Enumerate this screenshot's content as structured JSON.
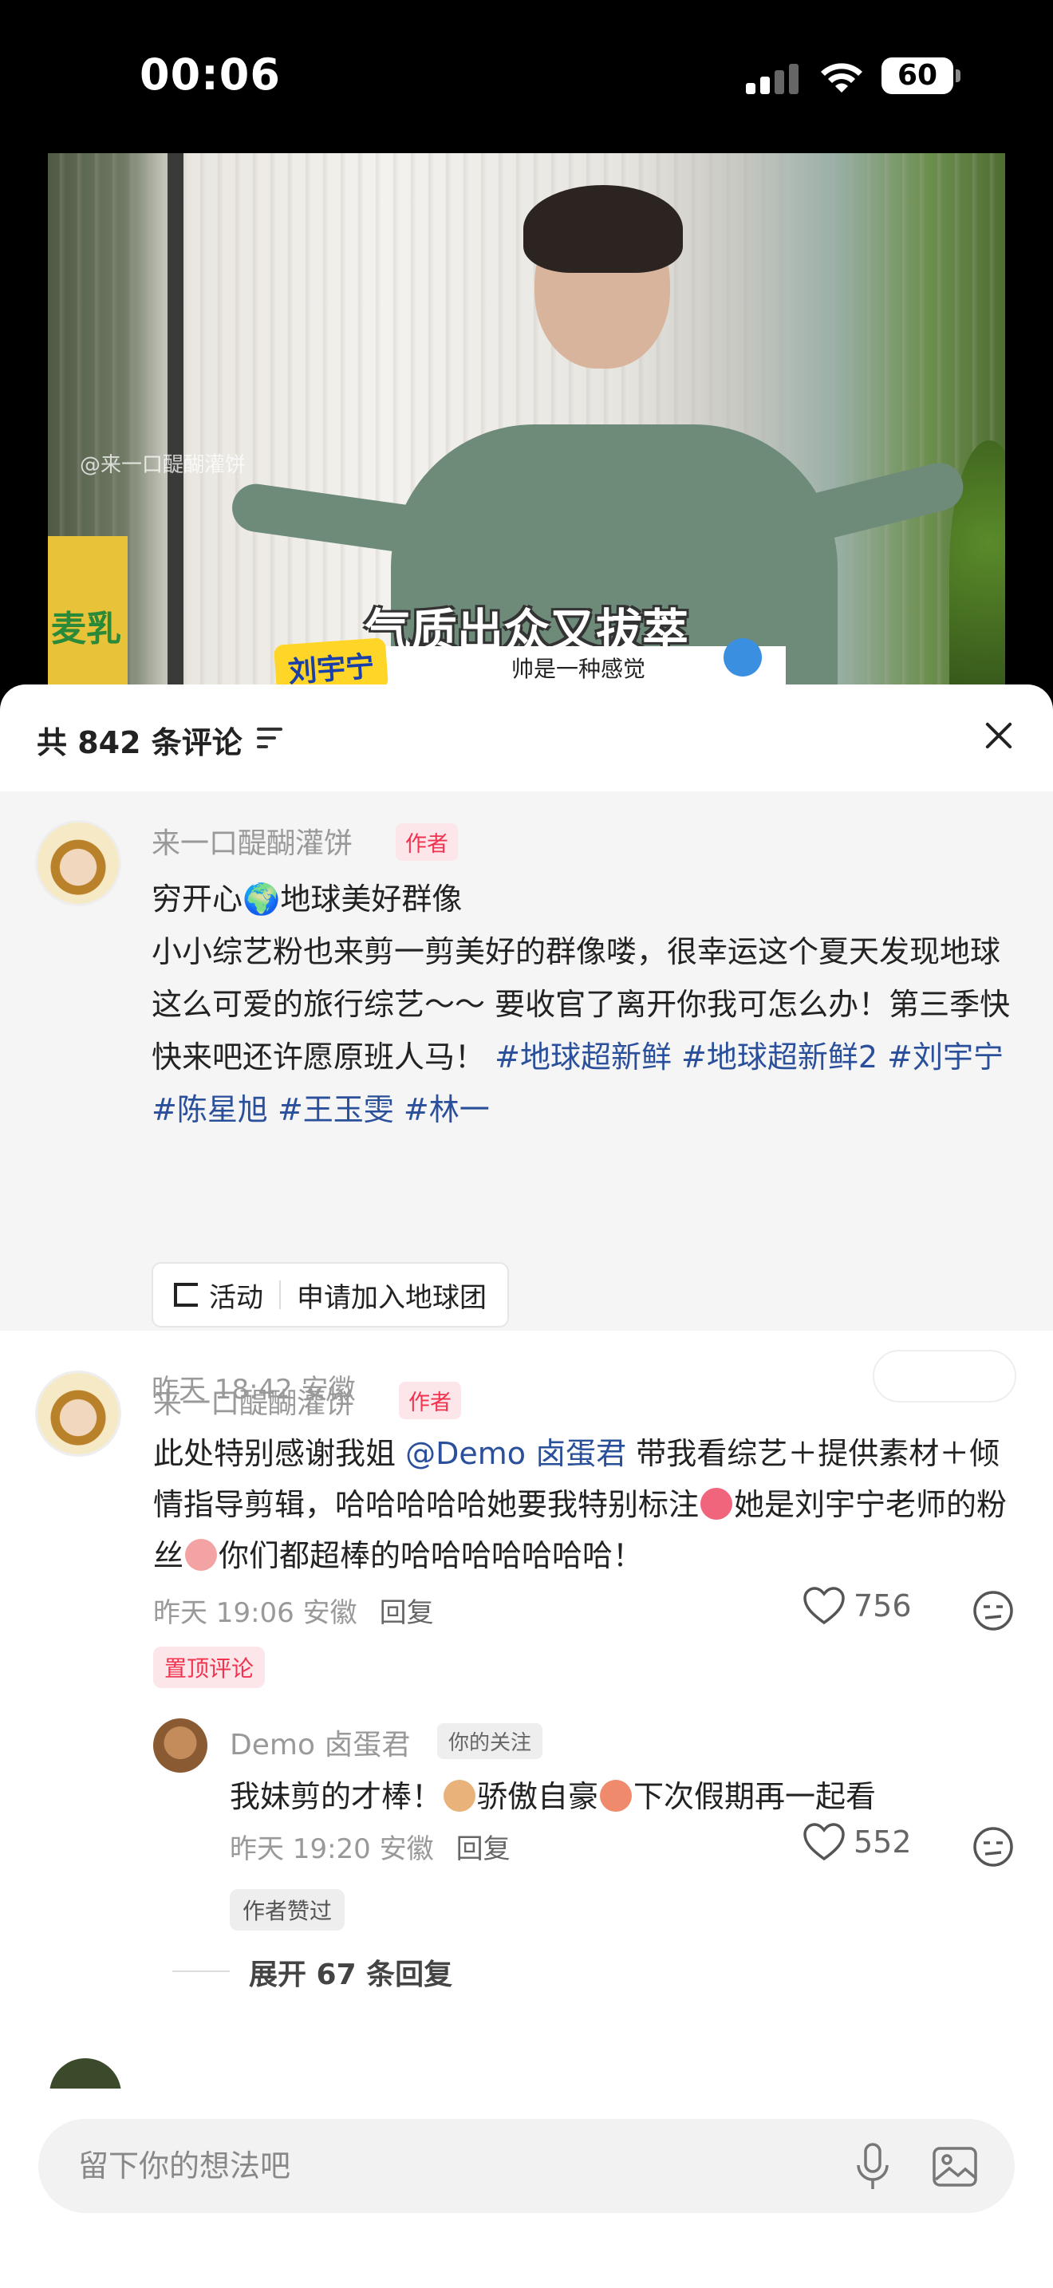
{
  "status_bar": {
    "time": "00:06",
    "battery": "60"
  },
  "video": {
    "subtitle_main": "气质出众又拔萃",
    "name_badge": "刘宇宁",
    "subtitle_sub": "帅是一种感觉"
  },
  "sheet": {
    "comment_count": "共 842 条评论",
    "filter_icon": "filter-icon",
    "close_icon": "close-icon"
  },
  "author_post": {
    "username": "来一口醍醐灌饼",
    "tag": "作者",
    "title": "穷开心🌍地球美好群像",
    "body": "小小综艺粉也来剪一剪美好的群像喽，很幸运这个夏天发现地球这么可爱的旅行综艺～～ 要收官了离开你我可怎么办！第三季快快来吧还许愿原班人马！",
    "hashtags": [
      "#地球超新鲜",
      "#地球超新鲜2",
      "#刘宇宁",
      "#陈星旭",
      "#王玉雯",
      "#林一"
    ],
    "activity_label": "活动",
    "activity_action": "申请加入地球团",
    "meta": "昨天 18:42 安徽"
  },
  "comments": [
    {
      "username": "来一口醍醐灌饼",
      "tag": "作者",
      "text_prefix": "此处特别感谢我姐",
      "mention": "@Demo 卤蛋君",
      "text_mid": "带我看综艺＋提供素材＋倾情指导剪辑，哈哈哈哈哈她要我特别标注",
      "text_mid2": "她是刘宇宁老师的粉丝",
      "text_suffix": "你们都超棒的哈哈哈哈哈哈哈！",
      "meta": "昨天 19:06 安徽",
      "reply_label": "回复",
      "likes": "756",
      "pinned_label": "置顶评论",
      "replies": [
        {
          "username": "Demo 卤蛋君",
          "tag": "你的关注",
          "text_a": "我妹剪的才棒！",
          "text_b": "骄傲自豪",
          "text_c": "下次假期再一起看",
          "meta": "昨天 19:20 安徽",
          "reply_label": "回复",
          "likes": "552",
          "liked_tag": "作者赞过"
        }
      ],
      "expand_label": "展开 67 条回复"
    }
  ],
  "input": {
    "placeholder": "留下你的想法吧",
    "mic_icon": "microphone-icon",
    "image_icon": "image-icon"
  },
  "colors": {
    "accent_red": "#f0334e",
    "link_blue": "#2a4f9b",
    "sheet_bg": "#ffffff",
    "author_bg": "#f5f5f5"
  }
}
